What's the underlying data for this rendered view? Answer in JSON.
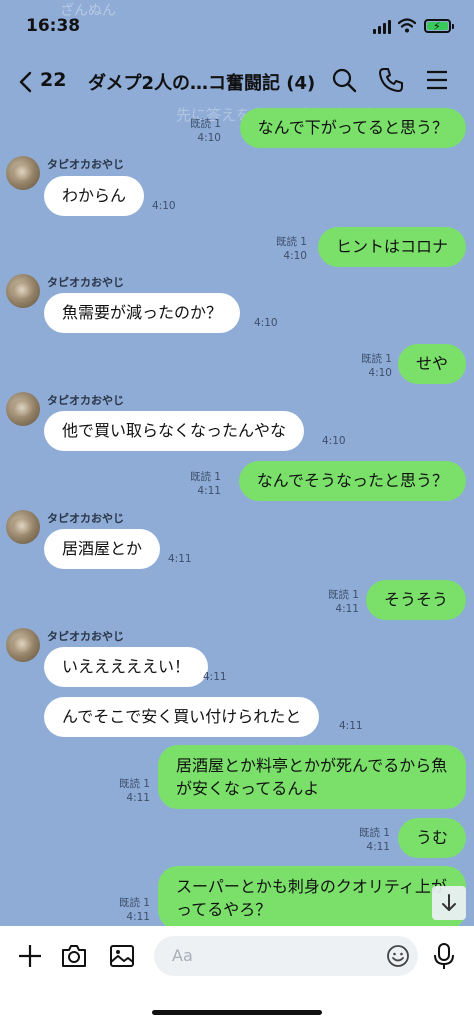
{
  "status_bar": {
    "time": "16:38"
  },
  "ghost": {
    "top": "ざんぬん",
    "notice": "先に答えを言うと感価が下がってる"
  },
  "header": {
    "back_count": "22",
    "title": "ダメプ2人の…コ奮闘記 (4)"
  },
  "icons": {
    "back": "chevron-left-icon",
    "search": "search-icon",
    "call": "phone-icon",
    "menu": "menu-icon",
    "plus": "plus-icon",
    "camera": "camera-icon",
    "image": "image-icon",
    "emoji": "emoji-icon",
    "mic": "microphone-icon",
    "scroll": "arrow-down-icon"
  },
  "messages": [
    {
      "side": "out",
      "text": "なんで下がってると思う？",
      "read": "既読 1",
      "time": "4:10"
    },
    {
      "side": "in",
      "sender": "タピオカおやじ",
      "text": "わからん",
      "time": "4:10"
    },
    {
      "side": "out",
      "text": "ヒントはコロナ",
      "read": "既読 1",
      "time": "4:10"
    },
    {
      "side": "in",
      "sender": "タピオカおやじ",
      "text": "魚需要が減ったのか？",
      "time": "4:10"
    },
    {
      "side": "out",
      "text": "せや",
      "read": "既読 1",
      "time": "4:10"
    },
    {
      "side": "in",
      "sender": "タピオカおやじ",
      "text": "他で買い取らなくなったんやな",
      "time": "4:10"
    },
    {
      "side": "out",
      "text": "なんでそうなったと思う？",
      "read": "既読 1",
      "time": "4:11"
    },
    {
      "side": "in",
      "sender": "タピオカおやじ",
      "text": "居酒屋とか",
      "time": "4:11"
    },
    {
      "side": "out",
      "text": "そうそう",
      "read": "既読 1",
      "time": "4:11"
    },
    {
      "side": "in",
      "sender": "タピオカおやじ",
      "text": "いえええええい！",
      "time": "4:11"
    },
    {
      "side": "in",
      "text": "んでそこで安く買い付けられたと",
      "time": "4:11"
    },
    {
      "side": "out",
      "text": "居酒屋とか料亭とかが死んでるから魚が安くなってるんよ",
      "read": "既読 1",
      "time": "4:11"
    },
    {
      "side": "out",
      "text": "うむ",
      "read": "既読 1",
      "time": "4:11"
    },
    {
      "side": "out",
      "text": "スーパーとかも刺身のクオリティ上がってるやろ？",
      "read": "既読 1",
      "time": "4:11"
    }
  ],
  "input": {
    "placeholder": "Aa"
  },
  "colors": {
    "background": "#8facd6",
    "out_bubble": "#7ae06a",
    "in_bubble": "#ffffff"
  }
}
